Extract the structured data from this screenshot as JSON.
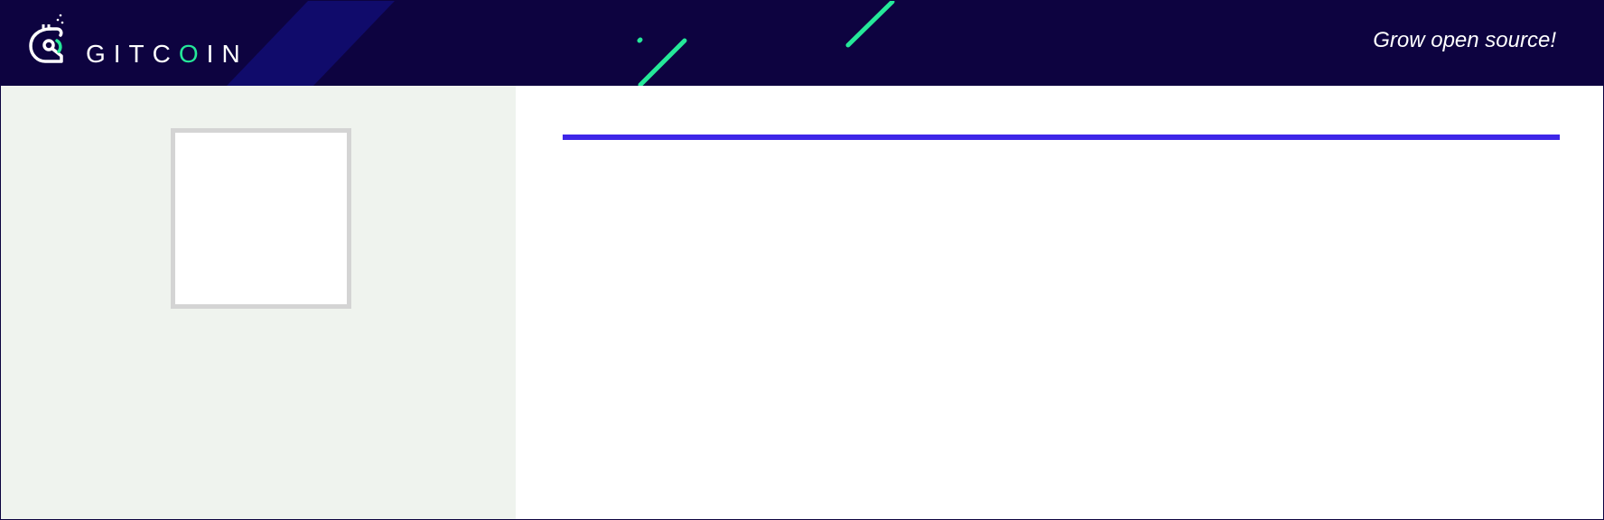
{
  "header": {
    "brand": {
      "name_prefix": "GITC",
      "name_accent_letter": "O",
      "name_suffix": "IN"
    },
    "tagline": "Grow open source!"
  },
  "icons": {
    "logo": "gitcoin-robot-logo-icon"
  },
  "colors": {
    "header_background": "#0d0340",
    "header_accent_stripe": "#100b6b",
    "brand_green": "#25e899",
    "sidebar_background": "#eff3ee",
    "avatar_border": "#d4d4d4",
    "accent_rule": "#3e26e8",
    "text_on_dark": "#ffffff"
  }
}
